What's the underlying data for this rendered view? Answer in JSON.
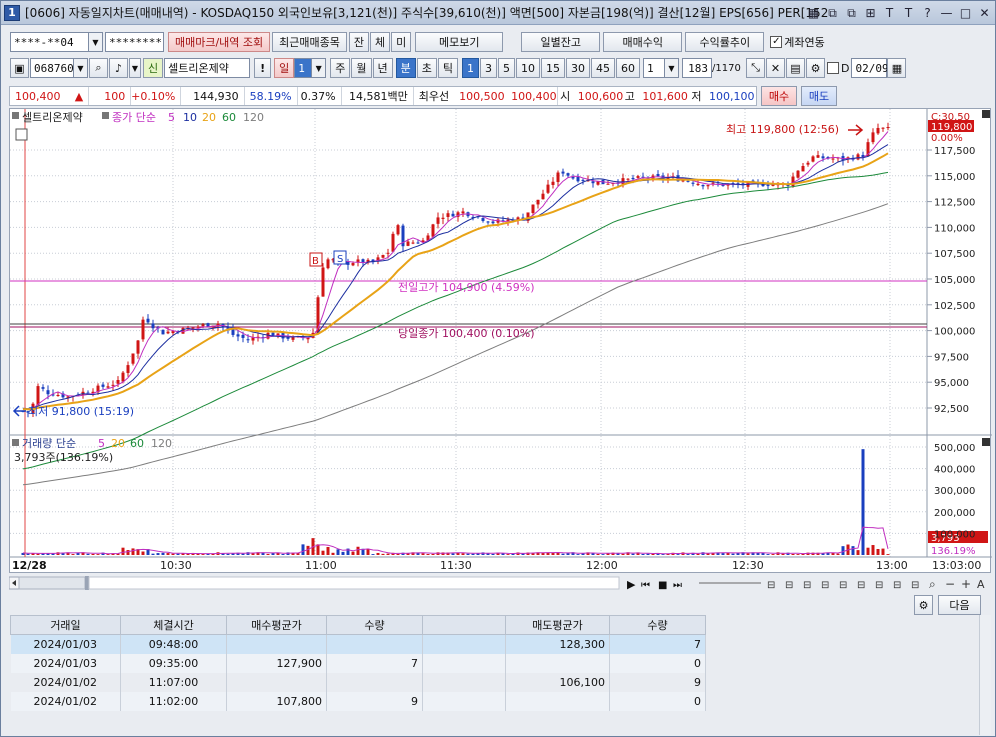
{
  "window": {
    "number": "1",
    "title": "[0606] 자동일지차트(매매내역) - KOSDAQ150 외국인보유[3,121(천)] 주식수[39,610(천)] 액면[500] 자본금[198(억)] 결산[12월] EPS[656] PER[152",
    "controls": [
      "▦",
      "⧉",
      "⧉",
      "⊞",
      "T",
      "T",
      "?",
      "—",
      "□",
      "✕"
    ]
  },
  "toolbar1": {
    "account": "****-**04",
    "password": "********",
    "btn_trades": "매매마크/내역 조회",
    "btn_recent": "최근매매종목",
    "btn_jan": "잔",
    "btn_che": "체",
    "btn_mi": "미",
    "btn_memo": "메모보기",
    "btn_daily": "일별잔고",
    "btn_profit": "매매수익",
    "btn_rate": "수익률추이",
    "chk_account": "계좌연동"
  },
  "toolbar2": {
    "code": "068760",
    "badge": "신",
    "stock_name": "셀트리온제약",
    "excl": "!",
    "period_label": "일",
    "period_value": "1",
    "periods": [
      "주",
      "월",
      "년"
    ],
    "units": [
      "분",
      "초",
      "틱"
    ],
    "minutes": [
      "1",
      "3",
      "5",
      "10",
      "15",
      "30",
      "45",
      "60"
    ],
    "interval": "1",
    "count": "183",
    "count_total": "/1170",
    "date": "02/09",
    "chk_d": "D"
  },
  "quote": {
    "price": "100,400",
    "change_arrow": "▲",
    "change": "100",
    "change_pct": "+0.10%",
    "volume": "144,930",
    "vol_ratio": "58.19%",
    "turnover": "0.37%",
    "amount": "14,581백만",
    "best_label": "최우선",
    "ask": "100,500",
    "bid": "100,400",
    "open_label": "시",
    "open": "100,600",
    "high_label": "고",
    "high": "101,600",
    "low_label": "저",
    "low": "100,100",
    "buy": "매수",
    "sell": "매도"
  },
  "chart": {
    "legend_name": "셀트리온제약",
    "legend_ma": "종가 단순",
    "ma_periods": [
      "5",
      "10",
      "20",
      "60",
      "120"
    ],
    "y_ticks": [
      "117,500",
      "115,000",
      "112,500",
      "110,000",
      "107,500",
      "105,000",
      "102,500",
      "100,000",
      "97,500",
      "95,000",
      "92,500"
    ],
    "y_top_labels": [
      "C:30.50",
      "0.00%"
    ],
    "current_price_tag": "119,800",
    "high_annotation": "최고 119,800 (12:56)",
    "low_annotation": "최저 91,800 (15:19)",
    "prev_high_line": "전일고가 104,900 (4.59%)",
    "prev_close_line": "당일종가 100,400 (0.10%)",
    "mark_buy": "B",
    "mark_sell": "S",
    "vol_legend": "거래량 단순",
    "vol_value": "3,793주(136.19%)",
    "vol_ticks": [
      "500,000",
      "400,000",
      "300,000",
      "200,000",
      "100,000"
    ],
    "vol_tag": "3,793",
    "vol_pct_tag": "136.19%",
    "x_labels": [
      "12/28",
      "10:30",
      "11:00",
      "11:30",
      "12:00",
      "12:30",
      "13:00",
      "13:03:00"
    ]
  },
  "table": {
    "headers": [
      "거래일",
      "체결시간",
      "매수평균가",
      "수량",
      "",
      "매도평균가",
      "수량"
    ],
    "rows": [
      [
        "2024/01/03",
        "09:48:00",
        "",
        "",
        "",
        "128,300",
        "7"
      ],
      [
        "2024/01/03",
        "09:35:00",
        "127,900",
        "7",
        "",
        "",
        "0"
      ],
      [
        "2024/01/02",
        "11:07:00",
        "",
        "",
        "",
        "106,100",
        "9"
      ],
      [
        "2024/01/02",
        "11:02:00",
        "107,800",
        "9",
        "",
        "",
        "0"
      ]
    ],
    "next": "다음"
  },
  "colors": {
    "up": "#d01515",
    "down": "#1a3fbf",
    "ma5": "#c02fc0",
    "ma10": "#1d2fa0",
    "ma20": "#e8a317",
    "ma60": "#1c8a3a",
    "ma120": "#7d7d7d"
  }
}
